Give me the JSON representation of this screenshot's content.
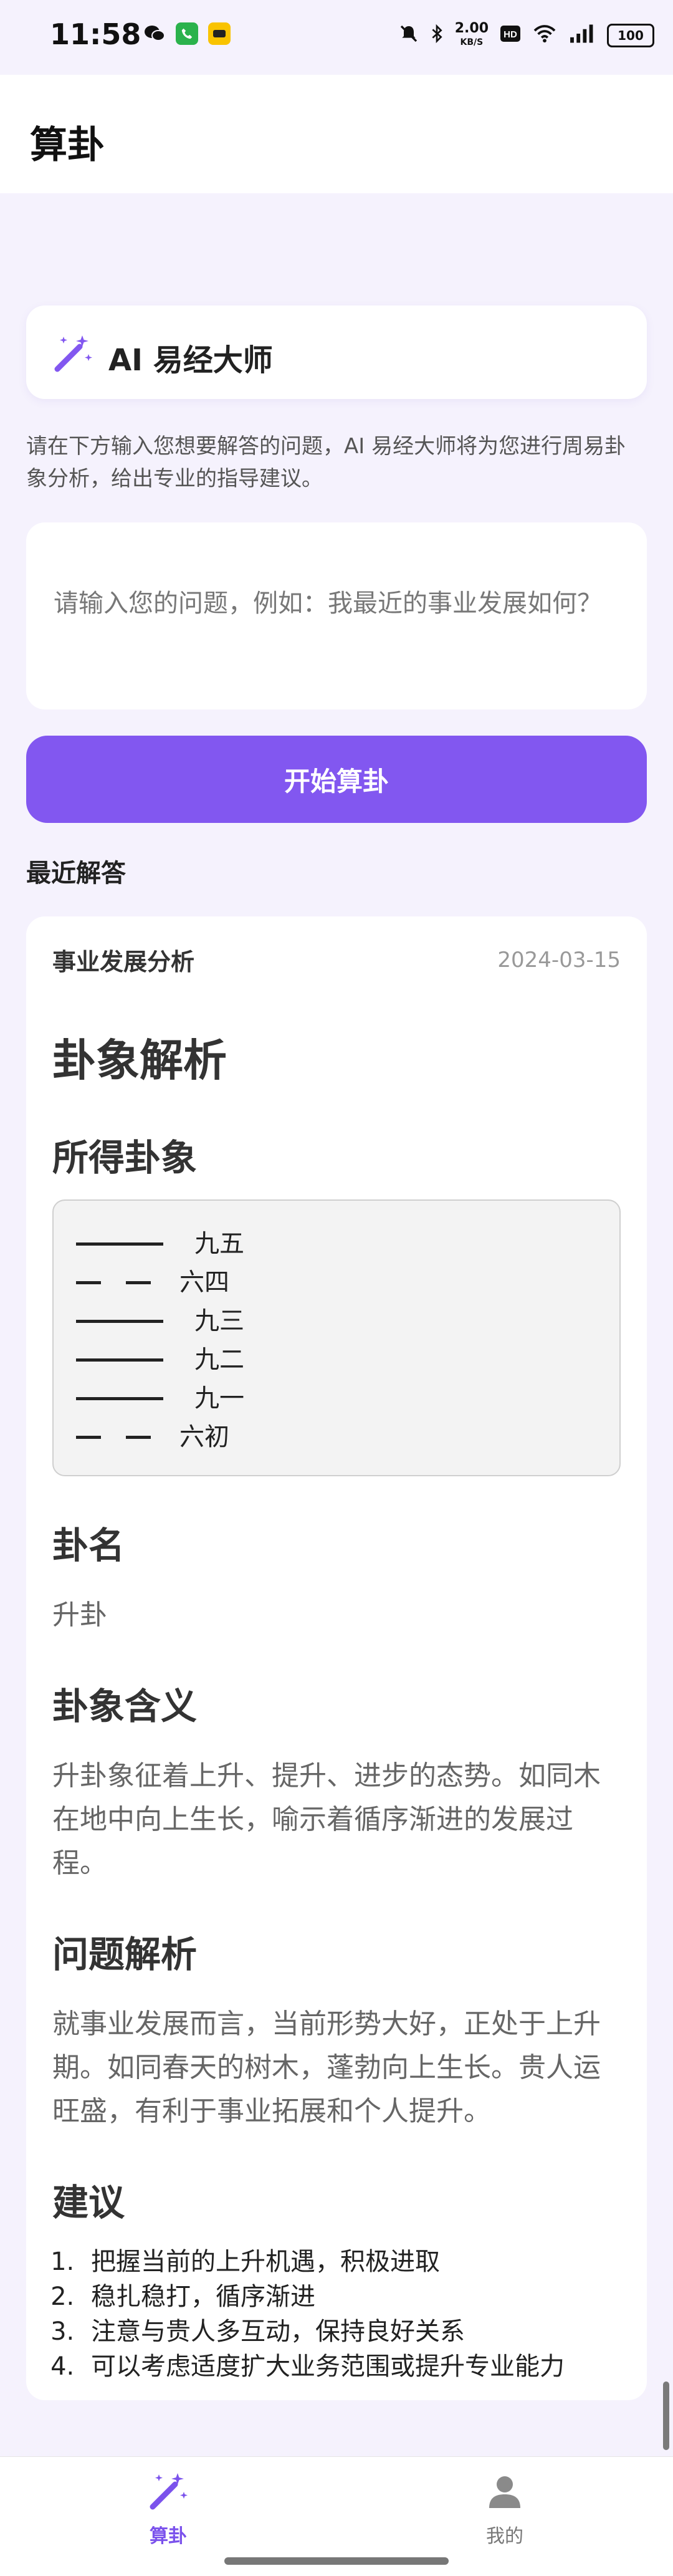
{
  "status_bar": {
    "time": "11:58",
    "network_speed": "2.00",
    "network_unit": "KB/S",
    "battery": "100"
  },
  "header": {
    "title": "算卦"
  },
  "hero": {
    "title": "AI 易经大师",
    "icon": "magic-wand-icon"
  },
  "intro": "请在下方输入您想要解答的问题，AI 易经大师将为您进行周易卦象分析，给出专业的指导建议。",
  "question": {
    "placeholder": "请输入您的问题，例如：我最近的事业发展如何？",
    "value": ""
  },
  "start_button": "开始算卦",
  "recent": {
    "title": "最近解答",
    "item": {
      "subject": "事业发展分析",
      "date": "2024-03-15",
      "heading": "卦象解析",
      "gua_heading": "所得卦象",
      "lines": [
        {
          "label": "九五",
          "yang": true
        },
        {
          "label": "六四",
          "yang": false
        },
        {
          "label": "九三",
          "yang": true
        },
        {
          "label": "九二",
          "yang": true
        },
        {
          "label": "九一",
          "yang": true
        },
        {
          "label": "六初",
          "yang": false
        }
      ],
      "name_heading": "卦名",
      "name": "升卦",
      "meaning_heading": "卦象含义",
      "meaning": "升卦象征着上升、提升、进步的态势。如同木在地中向上生长，喻示着循序渐进的发展过程。",
      "analysis_heading": "问题解析",
      "analysis": "就事业发展而言，当前形势大好，正处于上升期。如同春天的树木，蓬勃向上生长。贵人运旺盛，有利于事业拓展和个人提升。",
      "advice_heading": "建议",
      "advice": [
        "把握当前的上升机遇，积极进取",
        "稳扎稳打，循序渐进",
        "注意与贵人多互动，保持良好关系",
        "可以考虑适度扩大业务范围或提升专业能力"
      ]
    }
  },
  "nav": {
    "items": [
      {
        "label": "算卦",
        "icon": "magic-wand-icon",
        "active": true
      },
      {
        "label": "我的",
        "icon": "user-icon",
        "active": false
      }
    ]
  },
  "colors": {
    "accent": "#8257F0",
    "background": "#F5F2FD"
  }
}
